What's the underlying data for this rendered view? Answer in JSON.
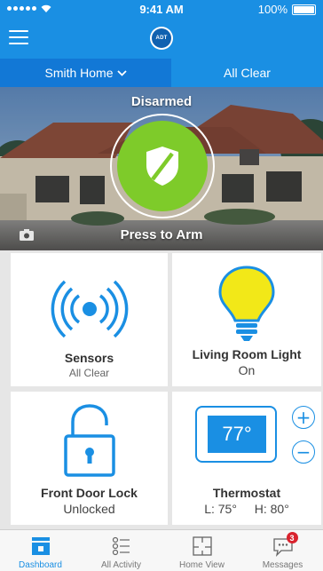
{
  "status_bar": {
    "time": "9:41 AM",
    "battery": "100%"
  },
  "header": {
    "logo_text": "ADT"
  },
  "location": {
    "home_name": "Smith Home",
    "system_status": "All Clear"
  },
  "hero": {
    "state_label": "Disarmed",
    "action_label": "Press to Arm"
  },
  "tiles": {
    "sensors": {
      "title": "Sensors",
      "subtitle": "All Clear"
    },
    "light": {
      "title": "Living Room Light",
      "subtitle": "On"
    },
    "lock": {
      "title": "Front Door Lock",
      "subtitle": "Unlocked"
    },
    "thermostat": {
      "title": "Thermostat",
      "current": "77°",
      "low": "L: 75°",
      "high": "H: 80°",
      "plus": "+",
      "minus": "−"
    }
  },
  "tabbar": {
    "tabs": [
      {
        "label": "Dashboard",
        "icon": "dashboard-icon",
        "active": true
      },
      {
        "label": "All Activity",
        "icon": "activity-list-icon"
      },
      {
        "label": "Home View",
        "icon": "floorplan-icon"
      },
      {
        "label": "Messages",
        "icon": "chat-icon",
        "badge": "3"
      }
    ]
  },
  "colors": {
    "brand_blue": "#1a8fe3",
    "arm_green": "#7ecb2a",
    "light_yellow": "#f2e818",
    "badge_red": "#d9232e"
  }
}
